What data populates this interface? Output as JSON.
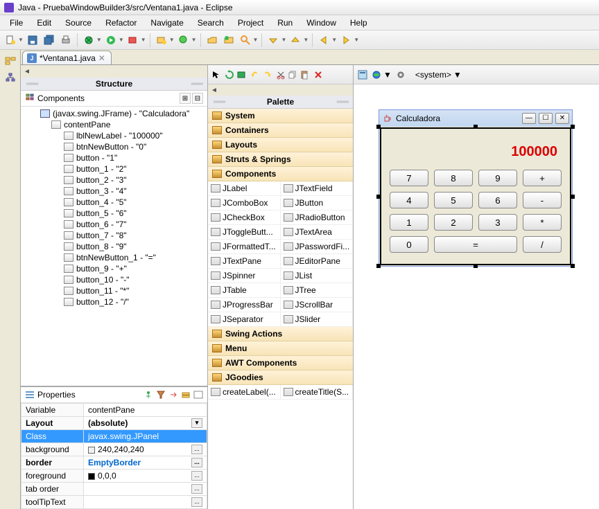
{
  "title": "Java - PruebaWindowBuilder3/src/Ventana1.java - Eclipse",
  "menu": [
    "File",
    "Edit",
    "Source",
    "Refactor",
    "Navigate",
    "Search",
    "Project",
    "Run",
    "Window",
    "Help"
  ],
  "editor_tab": "*Ventana1.java",
  "structure": {
    "title": "Structure",
    "components_label": "Components",
    "tree": {
      "root": "(javax.swing.JFrame) - \"Calculadora\"",
      "contentPane": "contentPane",
      "items": [
        "lblNewLabel - \"100000\"",
        "btnNewButton - \"0\"",
        "button - \"1\"",
        "button_1 - \"2\"",
        "button_2 - \"3\"",
        "button_3 - \"4\"",
        "button_4 - \"5\"",
        "button_5 - \"6\"",
        "button_6 - \"7\"",
        "button_7 - \"8\"",
        "button_8 - \"9\"",
        "btnNewButton_1 - \"=\"",
        "button_9 - \"+\"",
        "button_10 - \"-\"",
        "button_11 - \"*\"",
        "button_12 - \"/\""
      ]
    }
  },
  "properties": {
    "title": "Properties",
    "rows": [
      {
        "name": "Variable",
        "value": "contentPane"
      },
      {
        "name": "Layout",
        "value": "(absolute)",
        "dd": true,
        "bold": true
      },
      {
        "name": "Class",
        "value": "javax.swing.JPanel",
        "selected": true
      },
      {
        "name": "background",
        "value": "240,240,240",
        "color": "#f0f0f0",
        "btn": true
      },
      {
        "name": "border",
        "value": "EmptyBorder",
        "blue": true,
        "btn": true,
        "bold": true
      },
      {
        "name": "foreground",
        "value": "0,0,0",
        "color": "#000",
        "btn": true
      },
      {
        "name": "tab order",
        "value": "",
        "btn": true
      },
      {
        "name": "toolTipText",
        "value": "",
        "btn": true
      }
    ]
  },
  "palette": {
    "title": "Palette",
    "system_label": "<system>",
    "categories": [
      {
        "label": "System"
      },
      {
        "label": "Containers"
      },
      {
        "label": "Layouts"
      },
      {
        "label": "Struts & Springs"
      },
      {
        "label": "Components",
        "open": true,
        "items": [
          "JLabel",
          "JTextField",
          "JComboBox",
          "JButton",
          "JCheckBox",
          "JRadioButton",
          "JToggleButt...",
          "JTextArea",
          "JFormattedT...",
          "JPasswordFi...",
          "JTextPane",
          "JEditorPane",
          "JSpinner",
          "JList",
          "JTable",
          "JTree",
          "JProgressBar",
          "JScrollBar",
          "JSeparator",
          "JSlider"
        ]
      },
      {
        "label": "Swing Actions"
      },
      {
        "label": "Menu"
      },
      {
        "label": "AWT Components"
      },
      {
        "label": "JGoodies",
        "open": true,
        "items": [
          "createLabel(...",
          "createTitle(S..."
        ]
      }
    ]
  },
  "calculator": {
    "title": "Calculadora",
    "display": "100000",
    "buttons": [
      {
        "t": "7"
      },
      {
        "t": "8"
      },
      {
        "t": "9"
      },
      {
        "t": "+"
      },
      {
        "t": "4"
      },
      {
        "t": "5"
      },
      {
        "t": "6"
      },
      {
        "t": "-"
      },
      {
        "t": "1"
      },
      {
        "t": "2"
      },
      {
        "t": "3"
      },
      {
        "t": "*"
      },
      {
        "t": "0"
      },
      {
        "t": "=",
        "span": 2
      },
      {
        "t": "/"
      }
    ]
  }
}
